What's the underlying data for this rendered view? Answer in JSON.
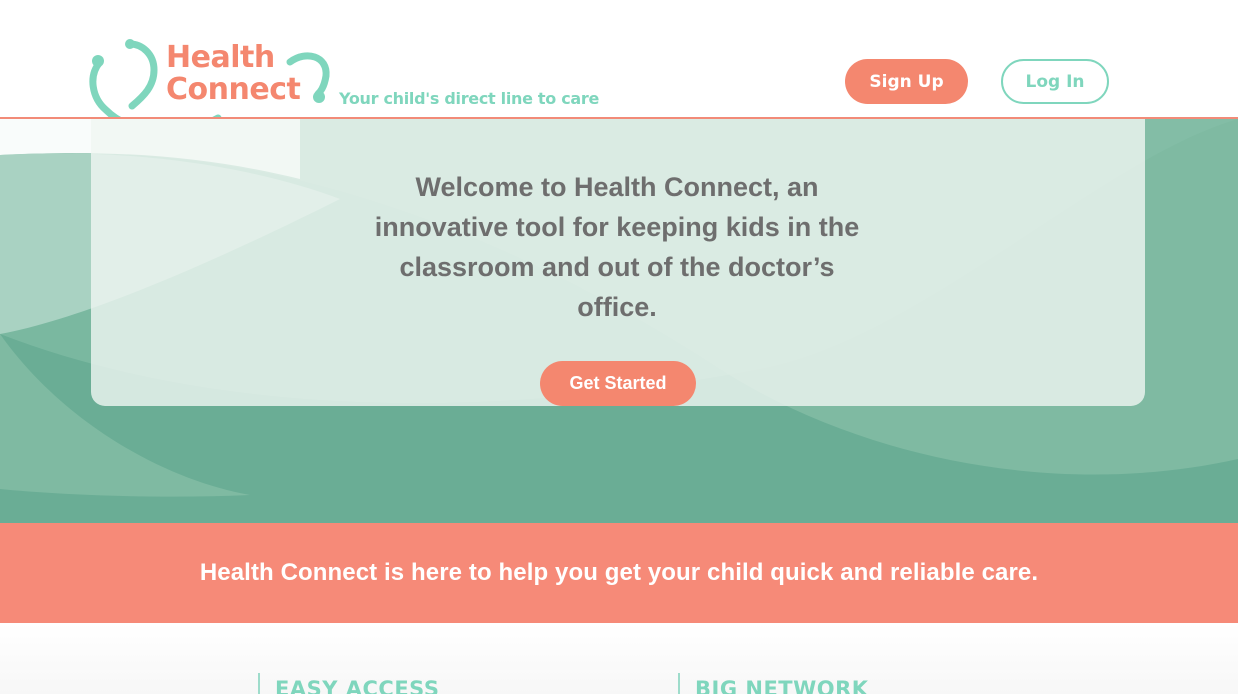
{
  "header": {
    "logo_line1": "Health",
    "logo_line2": "Connect",
    "tagline": "Your child's direct line to care",
    "signup_label": "Sign Up",
    "login_label": "Log In"
  },
  "hero": {
    "welcome_text": "Welcome to Health Connect, an innovative tool for keeping kids in the classroom and out of the doctor’s office.",
    "cta_label": "Get Started"
  },
  "banner": {
    "text": "Health Connect is here to help you get your child quick and reliable care."
  },
  "features": [
    {
      "title": "EASY ACCESS"
    },
    {
      "title": "BIG NETWORK"
    }
  ],
  "colors": {
    "brand_coral": "#f4876f",
    "brand_mint": "#7fd6bd",
    "hero_green": "#6aad95",
    "text_gray": "#6e6e6e"
  },
  "icons": {
    "logo": "stethoscope-icon"
  }
}
